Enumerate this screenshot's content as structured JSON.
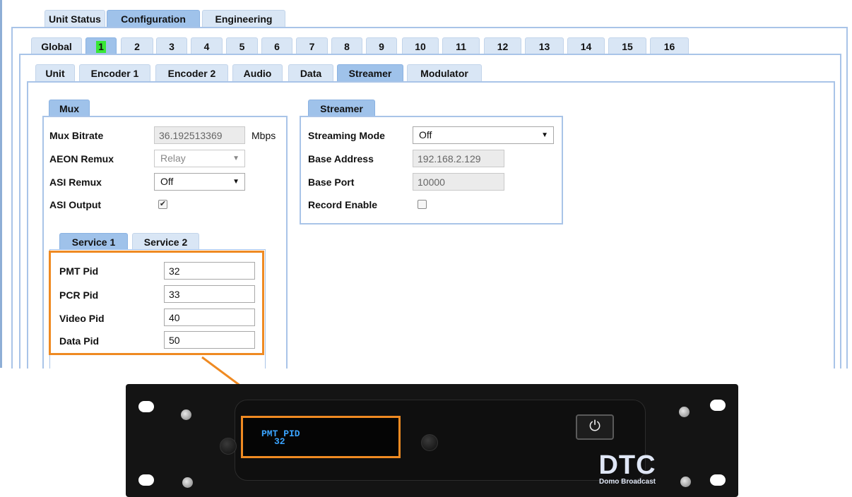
{
  "top_tabs": [
    "Unit Status",
    "Configuration",
    "Engineering"
  ],
  "channel_tabs": [
    "Global",
    "1",
    "2",
    "3",
    "4",
    "5",
    "6",
    "7",
    "8",
    "9",
    "10",
    "11",
    "12",
    "13",
    "14",
    "15",
    "16"
  ],
  "sub_tabs": [
    "Unit",
    "Encoder 1",
    "Encoder 2",
    "Audio",
    "Data",
    "Streamer",
    "Modulator"
  ],
  "mux": {
    "tab": "Mux",
    "bitrate_label": "Mux Bitrate",
    "bitrate_value": "36.192513369",
    "bitrate_unit": "Mbps",
    "aeon_label": "AEON Remux",
    "aeon_value": "Relay",
    "asi_remux_label": "ASI Remux",
    "asi_remux_value": "Off",
    "asi_output_label": "ASI Output",
    "asi_output_checked": true
  },
  "streamer": {
    "tab": "Streamer",
    "mode_label": "Streaming Mode",
    "mode_value": "Off",
    "address_label": "Base Address",
    "address_value": "192.168.2.129",
    "port_label": "Base Port",
    "port_value": "10000",
    "record_label": "Record Enable",
    "record_checked": false
  },
  "service": {
    "tabs": [
      "Service 1",
      "Service 2"
    ],
    "pmt_label": "PMT Pid",
    "pmt_value": "32",
    "pcr_label": "PCR Pid",
    "pcr_value": "33",
    "video_label": "Video Pid",
    "video_value": "40",
    "data_label": "Data Pid",
    "data_value": "50"
  },
  "device": {
    "display_line1": "PMT PID",
    "display_line2": "32",
    "logo": "DTC",
    "logo_sub": "Domo Broadcast"
  },
  "colors": {
    "highlight": "#ef8a22",
    "tab_active": "#9fc2ea",
    "tab": "#d9e6f5",
    "panel_border": "#a9c4e8",
    "oled": "#3aa4ff"
  }
}
